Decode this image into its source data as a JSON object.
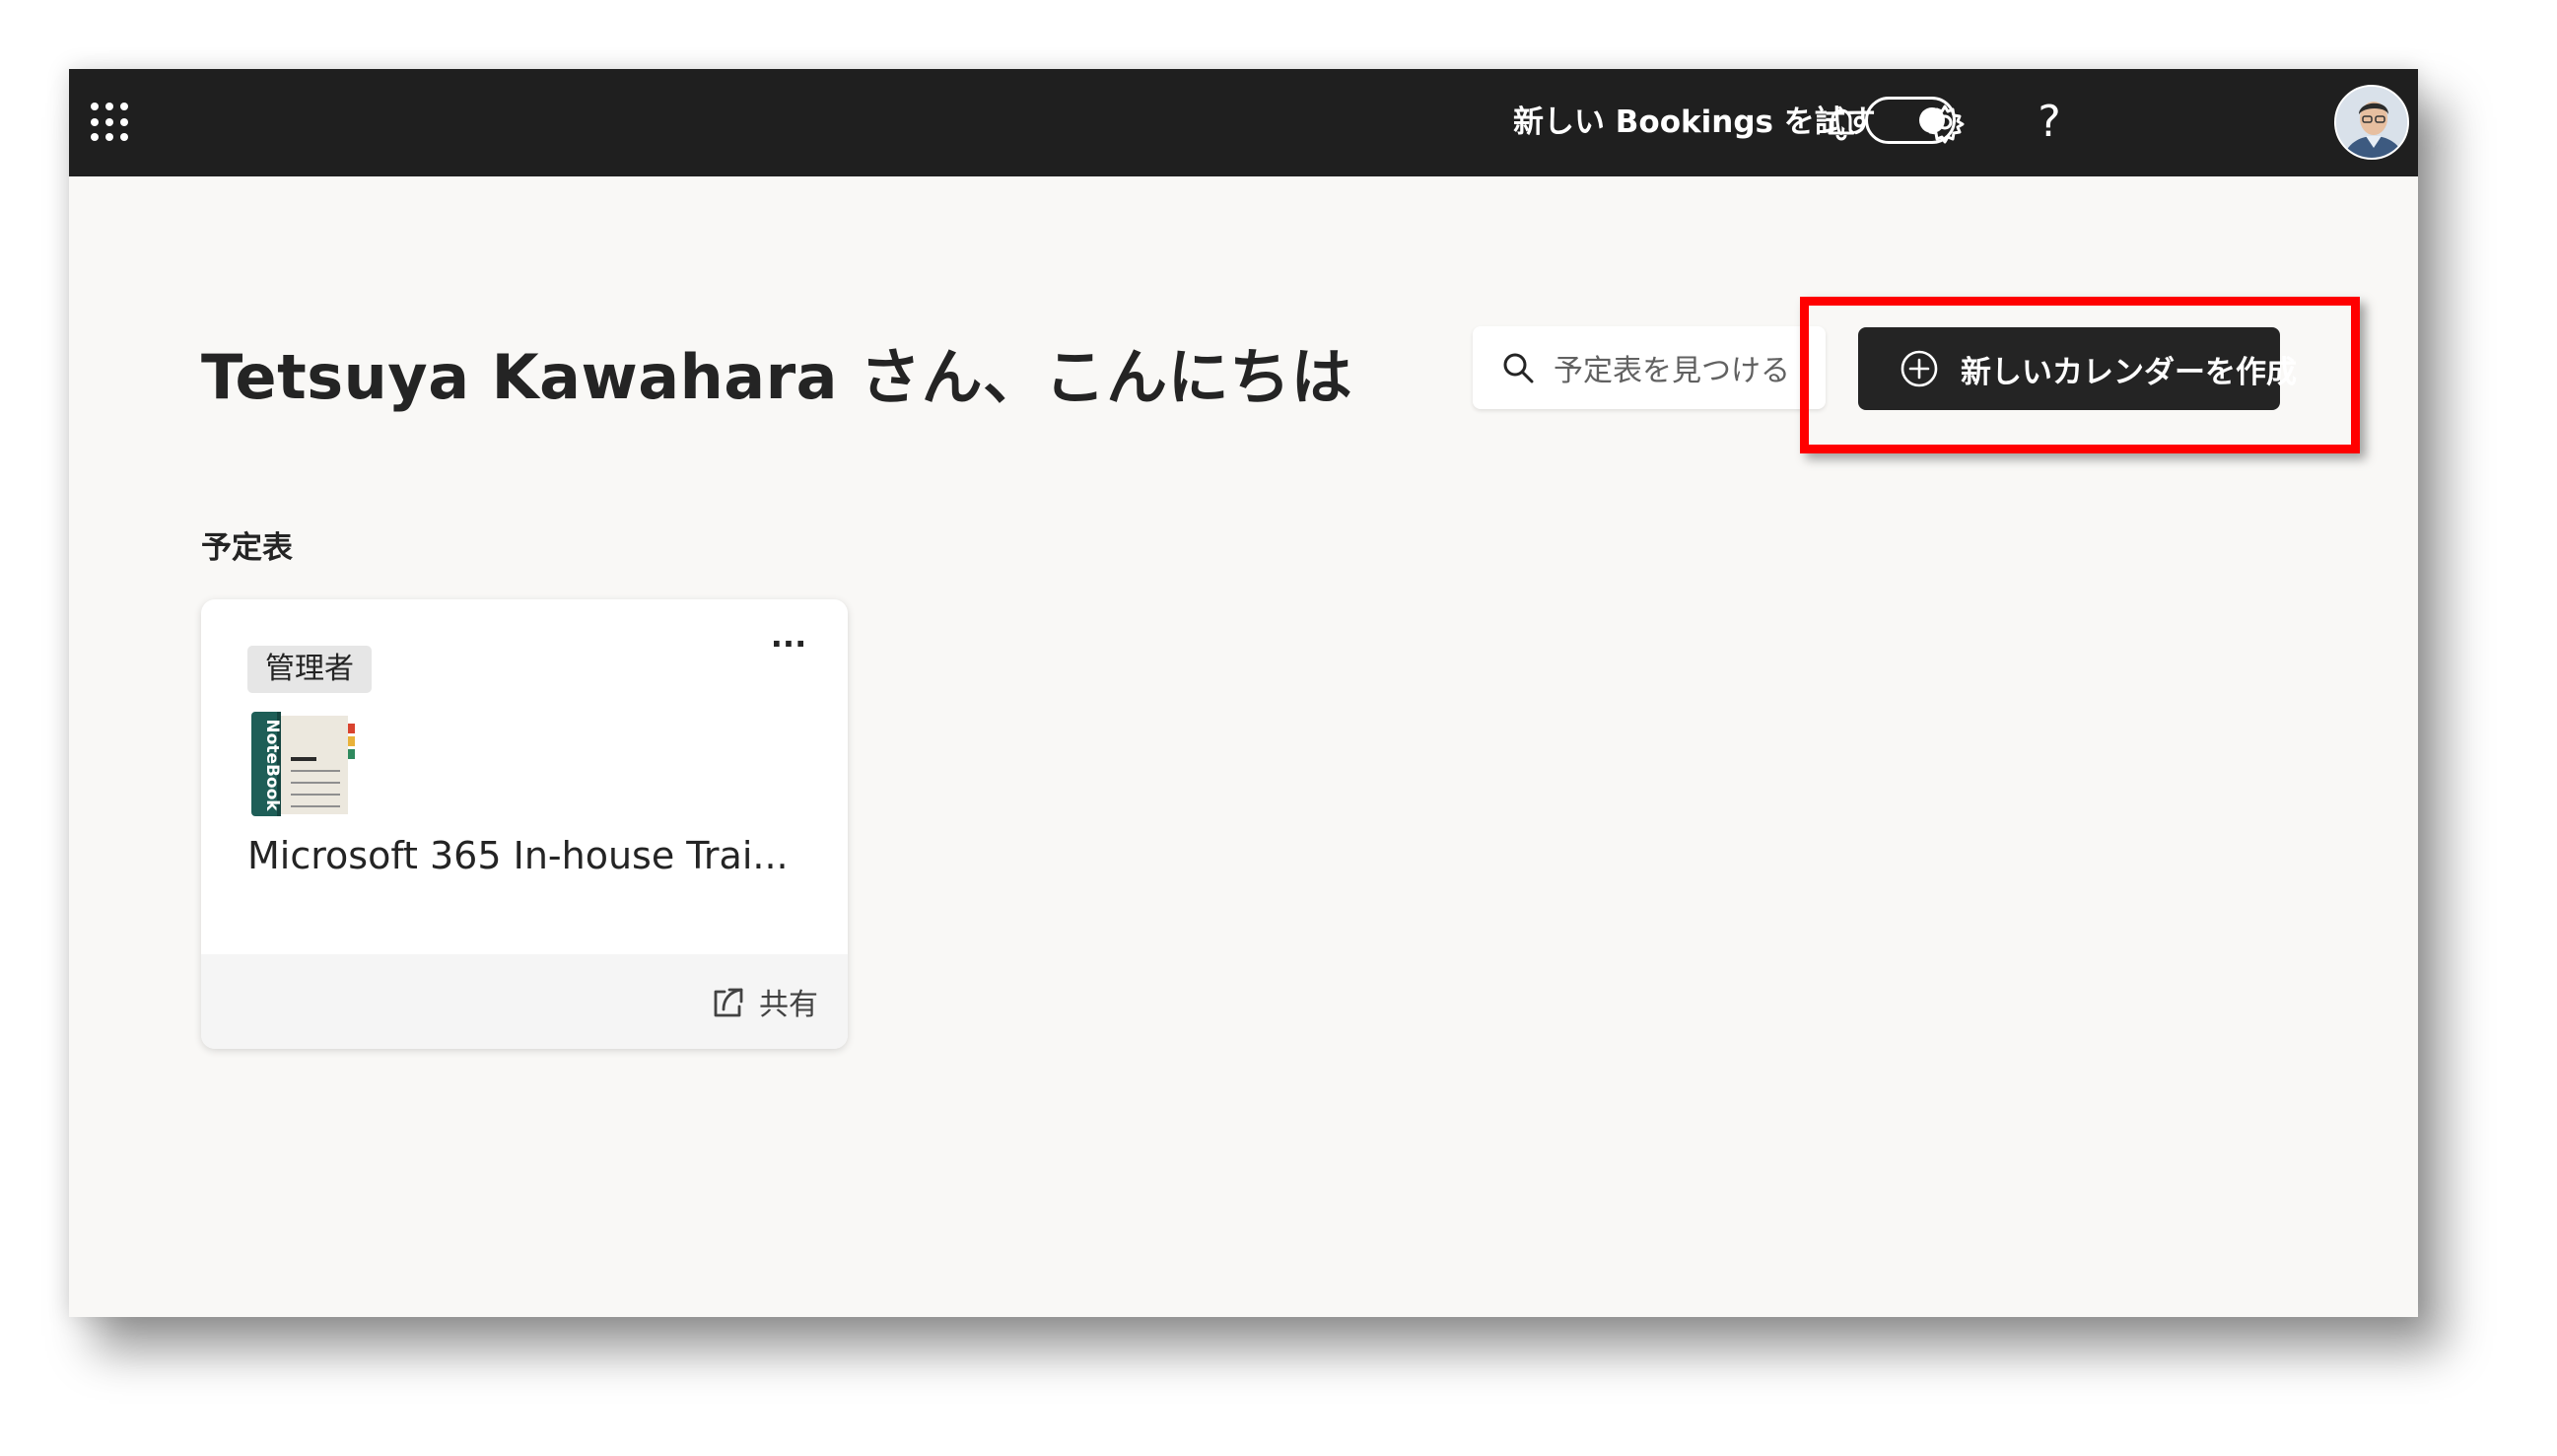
{
  "topbar": {
    "app_launcher_icon": "waffle-icon",
    "try_new_label": "新しい Bookings を試す",
    "toggle_state": "on",
    "notifications_icon": "bell-icon",
    "settings_icon": "gear-icon",
    "help_icon": "question-icon",
    "help_glyph": "?",
    "avatar": "user-avatar"
  },
  "main": {
    "greeting": "Tetsuya Kawahara さん、こんにちは",
    "search": {
      "icon": "search-icon",
      "placeholder": "予定表を見つける"
    },
    "create_button": {
      "icon": "add-circle-icon",
      "label": "新しいカレンダーを作成"
    },
    "highlight_color": "#ff0000",
    "section_title": "予定表",
    "calendars": [
      {
        "role": "管理者",
        "more_label": "···",
        "icon": "notebook-icon",
        "icon_text": "NoteBook",
        "name": "Microsoft 365 In-house Trai...",
        "share_label": "共有",
        "share_icon": "share-icon"
      }
    ]
  },
  "colors": {
    "topbar_bg": "#1f1f1f",
    "page_bg": "#f9f8f6",
    "primary_button": "#242424"
  }
}
